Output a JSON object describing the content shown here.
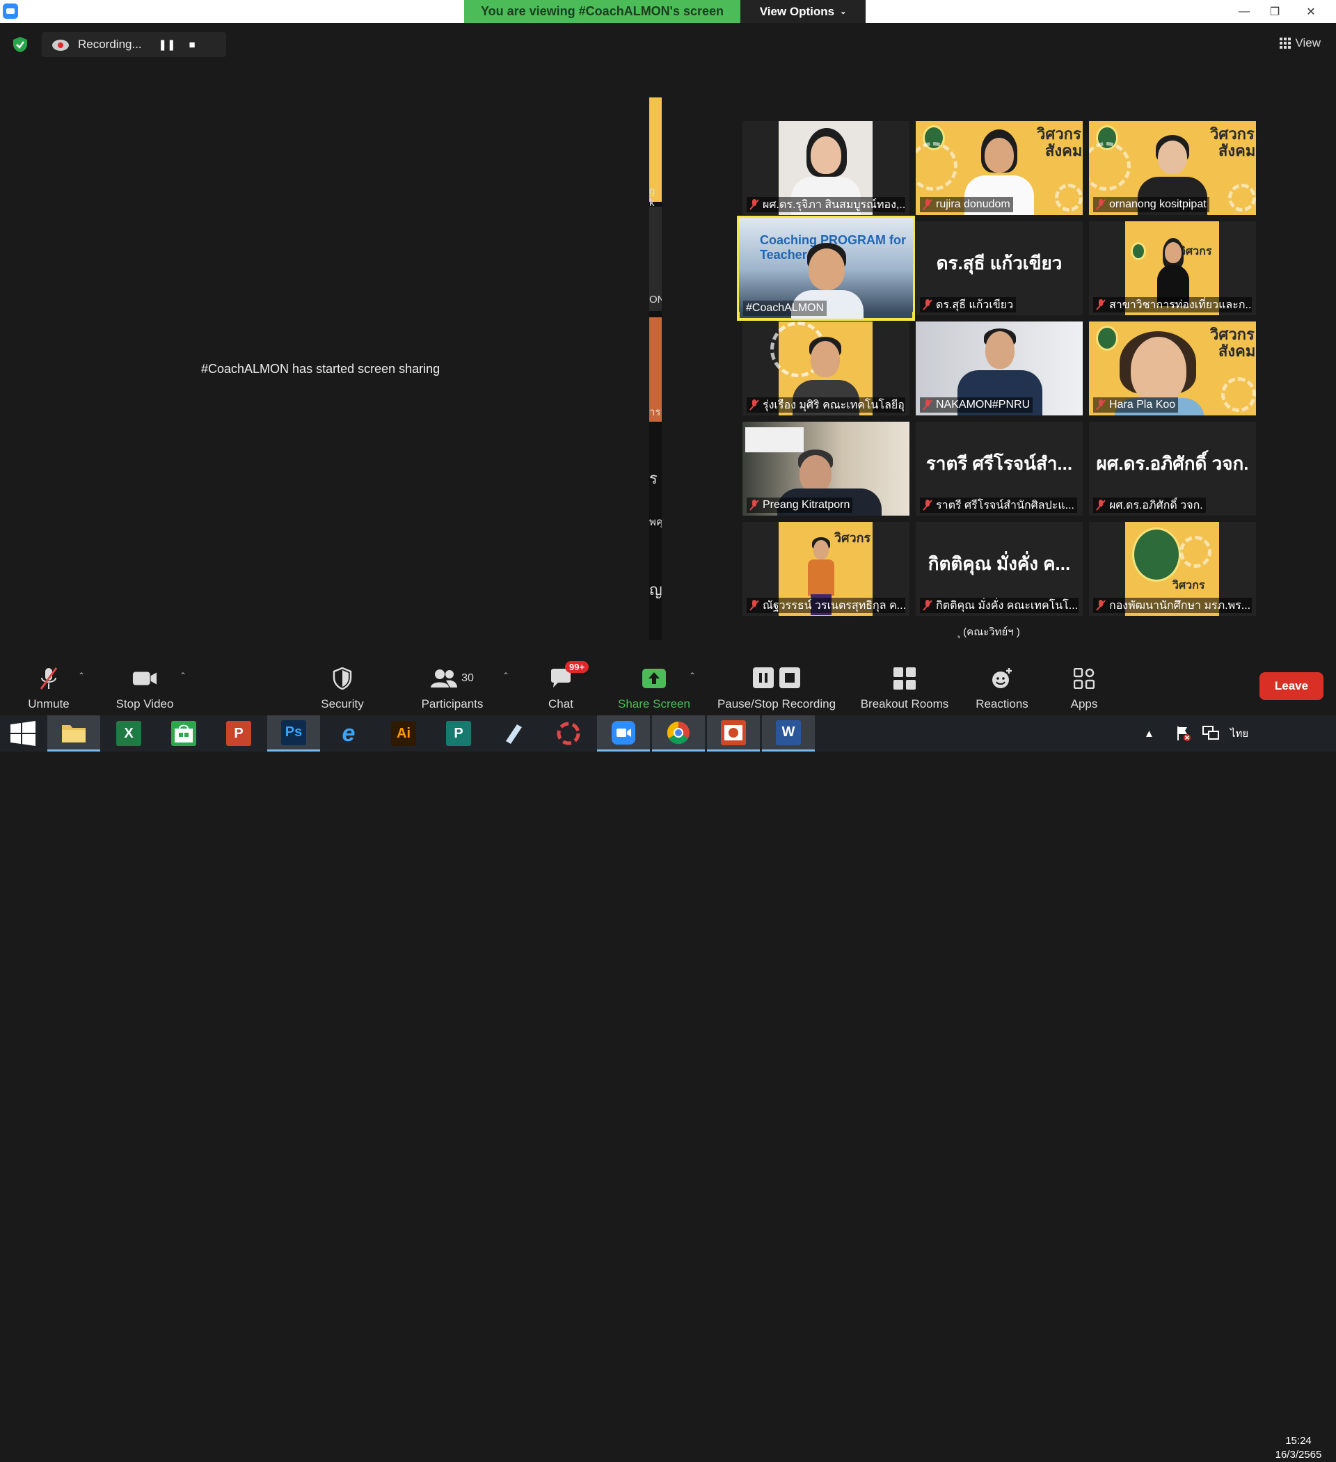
{
  "titlebar": {
    "viewing_banner": "You are viewing #CoachALMON's screen",
    "view_options": "View Options",
    "minimize": "—",
    "restore": "❐",
    "close": "✕"
  },
  "recording": {
    "status": "Recording...",
    "pause_glyph": "❚❚",
    "stop_glyph": "■"
  },
  "view_button": {
    "label": "View"
  },
  "share": {
    "message": "#CoachALMON has started screen sharing",
    "strip_texts": [
      "g k",
      "ON",
      "าร",
      "ร",
      "พคุ",
      "ญ"
    ]
  },
  "gallery": {
    "tiles": [
      {
        "name": "ผศ.ดร.รุจิภา สินสมบูรณ์ทอง,...",
        "type": "photo",
        "muted": true
      },
      {
        "name": "rujira donudom",
        "type": "poster",
        "muted": true
      },
      {
        "name": "ornanong kositpipat",
        "type": "poster",
        "muted": true
      },
      {
        "name": "#CoachALMON",
        "type": "active",
        "muted": false,
        "overlay": "Coaching PROGRAM for Teacher"
      },
      {
        "name": "ดร.สุธี  แก้วเขียว",
        "type": "text",
        "muted": true,
        "big": "ดร.สุธี  แก้วเขียว"
      },
      {
        "name": "สาขาวิชาการท่องเที่ยวและก...",
        "type": "poster-small",
        "muted": true
      },
      {
        "name": "รุ่งเรือง มุศิริ คณะเทคโนโลยีอุ...",
        "type": "photo-yellow",
        "muted": true
      },
      {
        "name": "NAKAMON#PNRU",
        "type": "photo-office",
        "muted": true
      },
      {
        "name": "Hara Pla Koo",
        "type": "poster",
        "muted": true
      },
      {
        "name": "Preang Kitratporn",
        "type": "photo-desk",
        "muted": true
      },
      {
        "name": "ราตรี  ศรีโรจน์สำนักศิลปะแ...",
        "type": "text",
        "muted": true,
        "big": "ราตรี  ศรีโรจน์สำ..."
      },
      {
        "name": "ผศ.ดร.อภิศักดิ์ วจก.",
        "type": "text",
        "muted": true,
        "big": "ผศ.ดร.อภิศักดิ์ วจก."
      },
      {
        "name": "ณัฐวรรธน์ วรเนตรสุทธิกุล ค...",
        "type": "poster-person",
        "muted": true
      },
      {
        "name": "กิตติคุณ  มั่งคั่ง คณะเทคโนโ...",
        "type": "text",
        "muted": true,
        "big": "กิตติคุณ  มั่งคั่ง ค..."
      },
      {
        "name": "กองพัฒนานักศึกษา มรภ.พร...",
        "type": "seal",
        "muted": true
      }
    ],
    "poster_title_line1": "วิศวกร",
    "poster_title_line2": "สังคม",
    "extra_label": "ุ (คณะวิทย์ฯ )"
  },
  "toolbar": {
    "unmute": "Unmute",
    "stop_video": "Stop Video",
    "security": "Security",
    "participants": "Participants",
    "participants_count": "30",
    "chat": "Chat",
    "chat_badge": "99+",
    "share_screen": "Share Screen",
    "pause_stop_recording": "Pause/Stop Recording",
    "breakout_rooms": "Breakout Rooms",
    "reactions": "Reactions",
    "apps": "Apps",
    "leave": "Leave"
  },
  "taskbar": {
    "apps": [
      {
        "icon": "file-explorer-icon",
        "letter": "",
        "color": "#e8c35a",
        "open": true
      },
      {
        "icon": "excel-icon",
        "letter": "X",
        "color": "#1f7a44",
        "open": false
      },
      {
        "icon": "store-icon",
        "letter": "",
        "color": "#2da84c",
        "open": false
      },
      {
        "icon": "powerpoint-icon",
        "letter": "P",
        "color": "#c8452b",
        "open": false
      },
      {
        "icon": "photoshop-icon",
        "letter": "Ps",
        "color": "#0e2a4d",
        "open": true
      },
      {
        "icon": "internet-explorer-icon",
        "letter": "e",
        "color": "#1f2328",
        "open": false
      },
      {
        "icon": "illustrator-icon",
        "letter": "Ai",
        "color": "#2d1a00",
        "open": false
      },
      {
        "icon": "publisher-icon",
        "letter": "P",
        "color": "#167a6e",
        "open": false
      },
      {
        "icon": "notepad-icon",
        "letter": "",
        "color": "#7fa6c9",
        "open": false
      },
      {
        "icon": "photoscape-icon",
        "letter": "",
        "color": "#1f2328",
        "open": false
      },
      {
        "icon": "zoom-icon",
        "letter": "",
        "color": "#2d8cff",
        "open": true
      },
      {
        "icon": "chrome-icon",
        "letter": "",
        "color": "#1f2328",
        "open": true
      },
      {
        "icon": "powerpoint-show-icon",
        "letter": "",
        "color": "#d24726",
        "open": true
      },
      {
        "icon": "word-icon",
        "letter": "W",
        "color": "#2b579a",
        "open": true
      }
    ],
    "language": "ไทย",
    "time": "15:24",
    "date": "16/3/2565"
  },
  "colors": {
    "accent_green": "#4cbc58",
    "leave_red": "#d93025",
    "active_speaker": "#f5e642",
    "poster_yellow": "#f2c14e"
  }
}
